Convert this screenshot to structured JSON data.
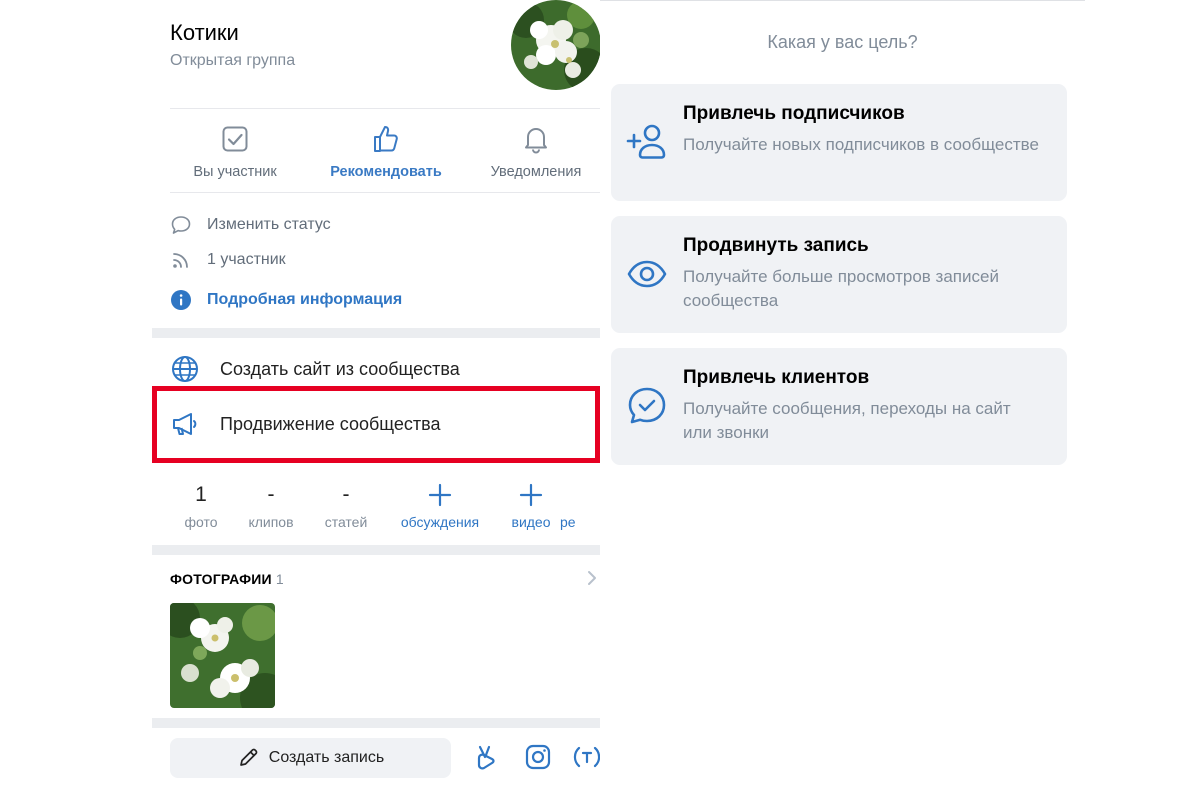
{
  "group": {
    "name": "Котики",
    "type": "Открытая группа"
  },
  "actions": [
    {
      "label": "Вы участник",
      "icon": "checkbox-icon"
    },
    {
      "label": "Рекомендовать",
      "icon": "thumbs-up-icon"
    },
    {
      "label": "Уведомления",
      "icon": "bell-icon"
    }
  ],
  "info": {
    "status": "Изменить статус",
    "members": "1 участник",
    "details": "Подробная информация"
  },
  "menu": {
    "create_site": "Создать сайт из сообщества",
    "promotion": "Продвижение сообщества"
  },
  "counters": [
    {
      "value": "1",
      "label": "фото"
    },
    {
      "value": "-",
      "label": "клипов"
    },
    {
      "value": "-",
      "label": "статей"
    },
    {
      "value": "+",
      "label": "обсуждения"
    },
    {
      "value": "+",
      "label": "видео"
    },
    {
      "value": "",
      "label": "ре"
    }
  ],
  "photos": {
    "title": "ФОТОГРАФИИ",
    "count": "1"
  },
  "bottom_bar": {
    "create_post": "Создать запись"
  },
  "goal": {
    "question": "Какая у вас цель?",
    "cards": [
      {
        "title": "Привлечь подписчиков",
        "desc": "Получайте новых подписчиков в сообществе",
        "icon": "add-user-icon"
      },
      {
        "title": "Продвинуть запись",
        "desc": "Получайте больше просмотров записей сообщества",
        "icon": "eye-icon"
      },
      {
        "title": "Привлечь клиентов",
        "desc": "Получайте сообщения, переходы на сайт или звонки",
        "icon": "message-check-icon"
      }
    ]
  },
  "colors": {
    "accent": "#2f76c4",
    "highlight": "#e60022",
    "muted_text": "#818c99",
    "card_bg": "#f0f2f5"
  }
}
